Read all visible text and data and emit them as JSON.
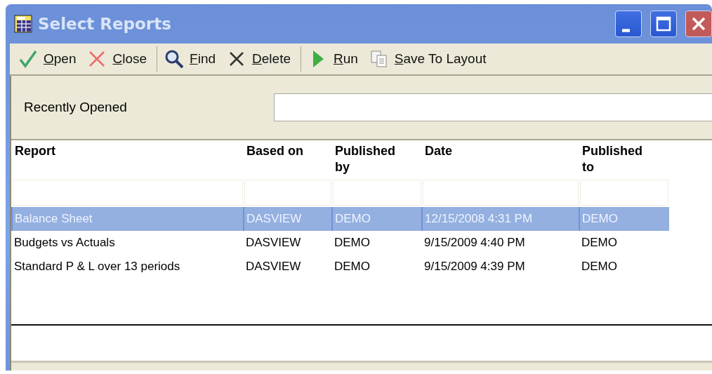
{
  "window": {
    "title": "Select Reports"
  },
  "toolbar": [
    {
      "kind": "check",
      "label": "Open"
    },
    {
      "kind": "cross",
      "label": "Close"
    },
    {
      "kind": "separator"
    },
    {
      "kind": "magnifier",
      "label": "Find"
    },
    {
      "kind": "x",
      "label": "Delete"
    },
    {
      "kind": "separator"
    },
    {
      "kind": "play",
      "label": "Run"
    },
    {
      "kind": "copy",
      "label": "Save To Layout"
    }
  ],
  "recently_opened": {
    "label": "Recently Opened"
  },
  "table": {
    "columns": [
      "Report",
      "Based on",
      "Published by",
      "Date",
      "Published to"
    ],
    "rows": [
      {
        "selected": true,
        "cells": [
          "Balance Sheet",
          "DASVIEW",
          "DEMO",
          "12/15/2008 4:31 PM",
          "DEMO"
        ]
      },
      {
        "selected": false,
        "cells": [
          "Budgets vs Actuals",
          "DASVIEW",
          "DEMO",
          "9/15/2009 4:40 PM",
          "DEMO"
        ]
      },
      {
        "selected": false,
        "cells": [
          "Standard P & L over 13 periods",
          "DASVIEW",
          "DEMO",
          "9/15/2009 4:39 PM",
          "DEMO"
        ]
      }
    ]
  }
}
